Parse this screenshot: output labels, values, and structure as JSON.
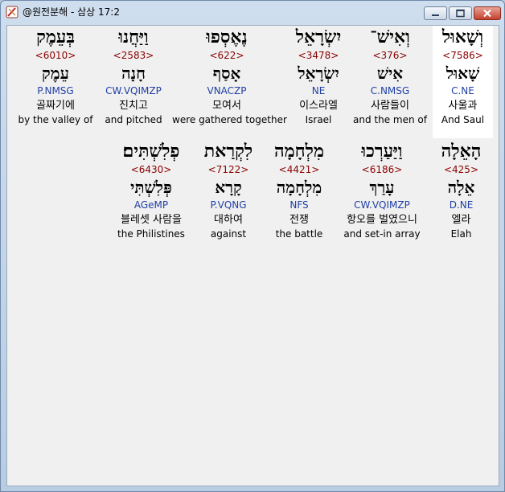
{
  "window": {
    "title": "@원전분해 - 삼상 17:2",
    "icon": "app-icon",
    "controls": {
      "minimize": "minimize-icon",
      "maximize": "maximize-icon",
      "close": "close-icon"
    }
  },
  "rows": [
    {
      "words": [
        {
          "hebrew": "וְשָׁאוּל",
          "strong": "<7586>",
          "lemma": "שָׁאוּל",
          "parse": "C.NE",
          "korean": "사울과",
          "english": "And Saul",
          "highlighted": true
        },
        {
          "hebrew": "וְאִישׁ־",
          "strong": "<376>",
          "lemma": "אִישׁ",
          "parse": "C.NMSG",
          "korean": "사람들이",
          "english": "and the men of"
        },
        {
          "hebrew": "יִשְׂרָאֵל",
          "strong": "<3478>",
          "lemma": "יִשְׂרָאֵל",
          "parse": "NE",
          "korean": "이스라엘",
          "english": "Israel"
        },
        {
          "hebrew": "נֶאֶסְפוּ",
          "strong": "<622>",
          "lemma": "אָסַף",
          "parse": "VNACZP",
          "korean": "모여서",
          "english": "were gathered together"
        },
        {
          "hebrew": "וַיַּחֲנוּ",
          "strong": "<2583>",
          "lemma": "חָנָה",
          "parse": "CW.VQIMZP",
          "korean": "진치고",
          "english": "and pitched"
        },
        {
          "hebrew": "בְּעֵמֶק",
          "strong": "<6010>",
          "lemma": "עֵמֶק",
          "parse": "P.NMSG",
          "korean": "골짜기에",
          "english": "by the valley of"
        }
      ]
    },
    {
      "words": [
        {
          "hebrew": "הָאֵלָה",
          "strong": "<425>",
          "lemma": "אֵלָה",
          "parse": "D.NE",
          "korean": "엘라",
          "english": "Elah"
        },
        {
          "hebrew": "וַיַּעַרְכוּ",
          "strong": "<6186>",
          "lemma": "עָרַךְ",
          "parse": "CW.VQIMZP",
          "korean": "항오를 벌였으니",
          "english": "and set-in array"
        },
        {
          "hebrew": "מִלְחָמָה",
          "strong": "<4421>",
          "lemma": "מִלְחָמָה",
          "parse": "NFS",
          "korean": "전쟁",
          "english": "the battle"
        },
        {
          "hebrew": "לִקְרַאת",
          "strong": "<7122>",
          "lemma": "קָרָא",
          "parse": "P.VQNG",
          "korean": "대하여",
          "english": "against"
        },
        {
          "hebrew": "פְלִשְׁתִּים׃",
          "strong": "<6430>",
          "lemma": "פְּלִשְׁתִּי",
          "parse": "AGeMP",
          "korean": "블레셋 사람을",
          "english": "the Philistines"
        }
      ]
    }
  ]
}
